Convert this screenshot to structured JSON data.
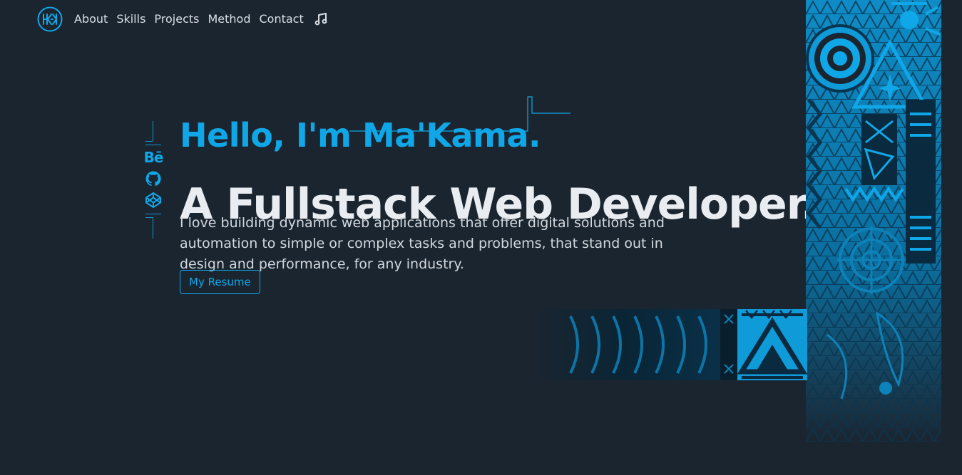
{
  "nav": {
    "logo_text": "MK",
    "links": [
      {
        "label": "About"
      },
      {
        "label": "Skills"
      },
      {
        "label": "Projects"
      },
      {
        "label": "Method"
      },
      {
        "label": "Contact"
      }
    ],
    "music_icon": "music-note-icon"
  },
  "social": {
    "items": [
      {
        "label": "Bē",
        "icon": "behance-icon"
      },
      {
        "label": "",
        "icon": "github-icon"
      },
      {
        "label": "",
        "icon": "codepen-icon"
      }
    ]
  },
  "hero": {
    "greeting": "Hello, I'm Ma'Kama.",
    "headline": "A Fullstack Web Developer.",
    "intro": "I love building dynamic web applications that offer digital solutions and automation to simple or complex tasks and problems, that stand out in design and performance, for any industry.",
    "resume_label": "My Resume"
  },
  "colors": {
    "background": "#1b2530",
    "accent": "#10a7e8",
    "heading": "#e9edf1",
    "body_text": "#d2d8de"
  }
}
